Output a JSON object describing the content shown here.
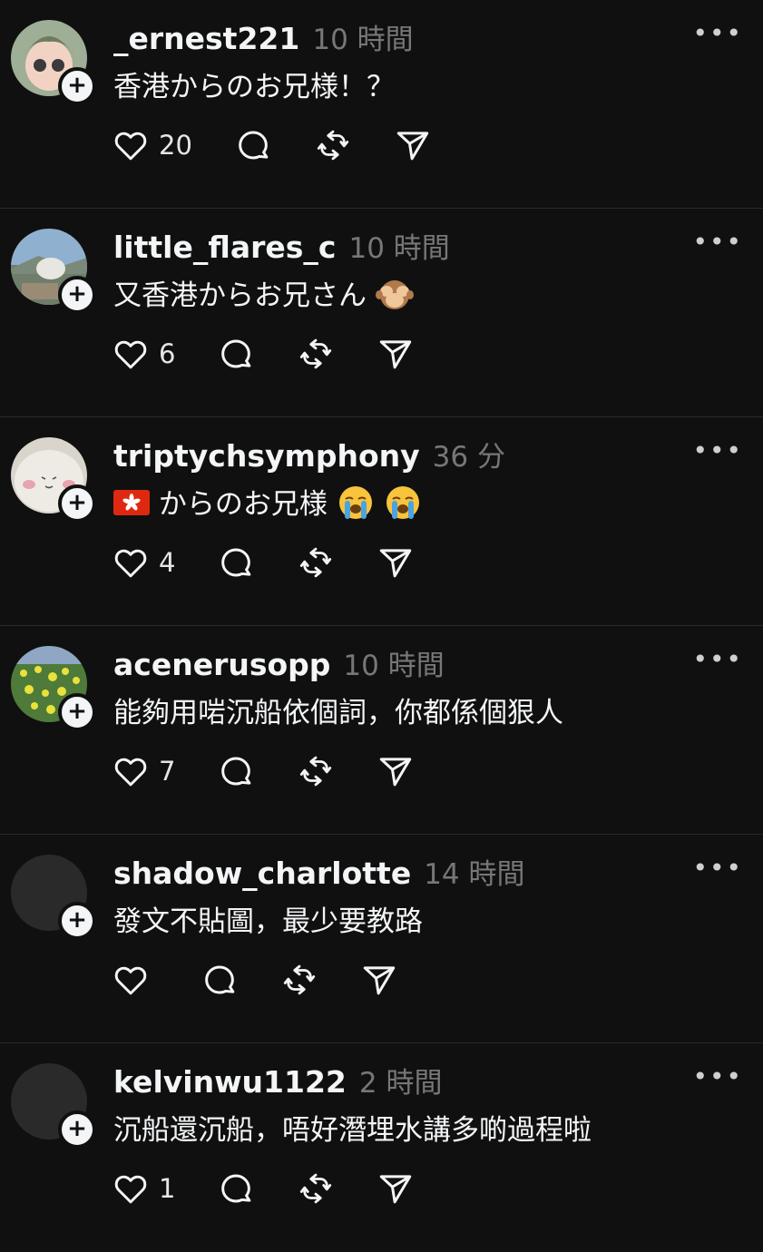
{
  "posts": [
    {
      "username": "_ernest221",
      "time": "10 時間",
      "text": "香港からのお兄様！？",
      "likes": "20",
      "avatar": "anime-avatar"
    },
    {
      "username": "little_flares_c",
      "time": "10 時間",
      "text": "又香港からお兄さん",
      "likes": "6",
      "avatar": "landscape-avatar",
      "emoji": "see-no-evil-monkey"
    },
    {
      "username": "triptychsymphony",
      "time": "36 分",
      "text": "からのお兄様",
      "likes": "4",
      "avatar": "plush-avatar",
      "emoji": "loudly-crying-face"
    },
    {
      "username": "acenerusopp",
      "time": "10 時間",
      "text": "能夠用啱沉船依個詞，你都係個狠人",
      "likes": "7",
      "avatar": "flowers-avatar"
    },
    {
      "username": "shadow_charlotte",
      "time": "14 時間",
      "text": "發文不貼圖，最少要教路",
      "likes": "",
      "avatar": "blank-avatar"
    },
    {
      "username": "kelvinwu1122",
      "time": "2 時間",
      "text": "沉船還沉船，唔好潛埋水講多啲過程啦",
      "likes": "1",
      "avatar": "blank-avatar"
    }
  ],
  "ui": {
    "more": "•••",
    "follow": "+"
  }
}
